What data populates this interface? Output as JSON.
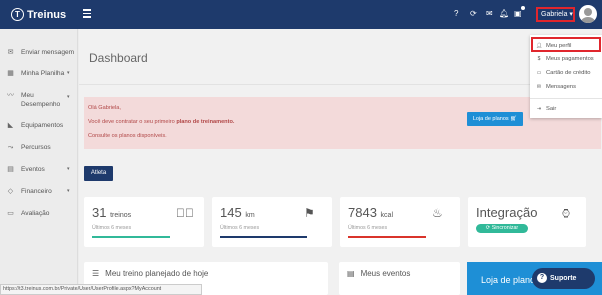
{
  "header": {
    "brand": "Treinus",
    "user_name": "Gabriela"
  },
  "sidebar": {
    "items": [
      {
        "label": "Enviar mensagem",
        "icon": "envelope-icon"
      },
      {
        "label": "Minha Planilha",
        "icon": "grid-icon",
        "caret": "▾"
      },
      {
        "label": "Meu Desempenho",
        "icon": "chart-line-icon",
        "caret": "▾"
      },
      {
        "label": "Equipamentos",
        "icon": "shoe-icon"
      },
      {
        "label": "Percursos",
        "icon": "route-icon"
      },
      {
        "label": "Eventos",
        "icon": "calendar-icon",
        "caret": "▾"
      },
      {
        "label": "Financeiro",
        "icon": "tag-icon",
        "caret": "▾"
      },
      {
        "label": "Avaliação",
        "icon": "card-icon"
      }
    ]
  },
  "page": {
    "title": "Dashboard"
  },
  "alert": {
    "line1": "Olá Gabriela,",
    "line2_prefix": "Você deve contratar o seu primeiro ",
    "line2_bold": "plano de treinamento.",
    "line3": "Consulte os planos disponíveis.",
    "button": "Loja de planos"
  },
  "tabs": {
    "atleta": "Atleta"
  },
  "cards": [
    {
      "value": "31",
      "unit": "treinos",
      "sub": "Últimos 6 meses",
      "bar_color": "#31b999",
      "icon": "check-circle-icon"
    },
    {
      "value": "145",
      "unit": "km",
      "sub": "Últimos 6 meses",
      "bar_color": "#1e3a6c",
      "icon": "signpost-icon"
    },
    {
      "value": "7843",
      "unit": "kcal",
      "sub": "Últimos 6 meses",
      "bar_color": "#d9342b",
      "icon": "flame-icon"
    },
    {
      "value": "Integração",
      "sync_label": "Sincronizar",
      "icon": "watch-icon"
    }
  ],
  "bottom": {
    "treino_title": "Meu treino planejado de hoje",
    "eventos_title": "Meus eventos",
    "planos_title": "Loja de planos"
  },
  "support": {
    "label": "Suporte"
  },
  "status_url": "https://t3.treinus.com.br/Private/User/UserProfile.aspx?MyAccount",
  "dropdown": {
    "items": [
      {
        "label": "Meu perfil",
        "icon": "user-icon"
      },
      {
        "label": "Meus pagamentos",
        "icon": "dollar-icon"
      },
      {
        "label": "Cartão de crédito",
        "icon": "credit-card-icon"
      },
      {
        "label": "Mensagens",
        "icon": "envelope-icon"
      },
      {
        "label": "Sair",
        "icon": "logout-icon"
      }
    ]
  },
  "colors": {
    "navy": "#1e3a6c",
    "accent_blue": "#1e8fd6",
    "alert_bg": "#f3dada",
    "alert_text": "#b14747",
    "highlight_red": "#e0262d"
  }
}
